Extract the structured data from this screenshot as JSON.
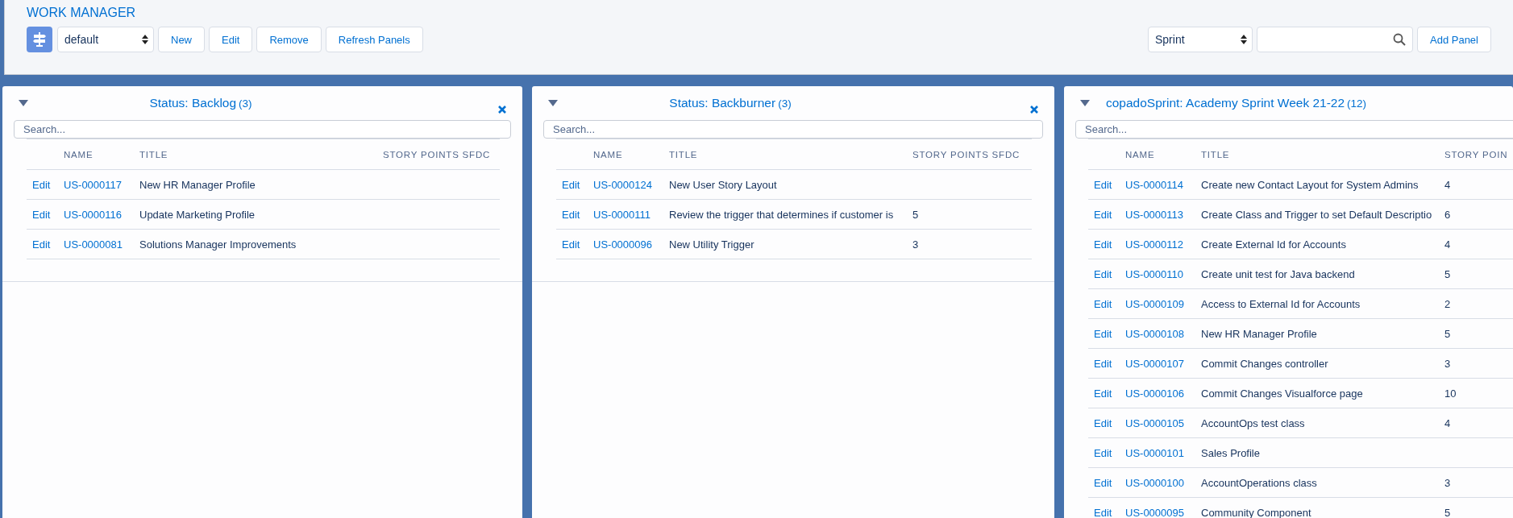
{
  "header": {
    "title": "WORK MANAGER",
    "layout_select": {
      "value": "default"
    },
    "buttons": [
      "New",
      "Edit",
      "Remove",
      "Refresh Panels"
    ],
    "panel_type_select": {
      "value": "Sprint"
    },
    "add_button": "Add Panel"
  },
  "panels": [
    {
      "title": "Status: Backlog",
      "count": "(3)",
      "expanded": true,
      "closable": true,
      "search": {
        "placeholder": "Search..."
      },
      "columns": [
        "NAME",
        "TITLE",
        "STORY POINTS SFDC"
      ],
      "rows": [
        {
          "action": "Edit",
          "name": "US-0000117",
          "title": "New HR Manager Profile"
        },
        {
          "action": "Edit",
          "name": "US-0000116",
          "title": "Update Marketing Profile"
        },
        {
          "action": "Edit",
          "name": "US-0000081",
          "title": "Solutions Manager Improvements"
        }
      ]
    },
    {
      "title": "Status: Backburner",
      "count": "(3)",
      "expanded": true,
      "closable": true,
      "search": {
        "placeholder": "Search..."
      },
      "columns": [
        "NAME",
        "TITLE",
        "STORY POINTS SFDC"
      ],
      "rows": [
        {
          "action": "Edit",
          "name": "US-0000124",
          "title": "New User Story Layout"
        },
        {
          "action": "Edit",
          "name": "US-0000111",
          "title": "Review the trigger that determines if customer is",
          "points": "5"
        },
        {
          "action": "Edit",
          "name": "US-0000096",
          "title": "New Utility Trigger",
          "points": "3"
        }
      ]
    },
    {
      "title": "copadoSprint: Academy Sprint Week 21-22",
      "count": "(12)",
      "expanded": true,
      "closable": false,
      "search": {
        "placeholder": "Search..."
      },
      "columns": [
        "NAME",
        "TITLE",
        "STORY POIN"
      ],
      "rows": [
        {
          "action": "Edit",
          "name": "US-0000114",
          "title": "Create new Contact Layout for System Admins",
          "points": "4"
        },
        {
          "action": "Edit",
          "name": "US-0000113",
          "title": "Create Class and Trigger to set Default Descriptio",
          "points": "6"
        },
        {
          "action": "Edit",
          "name": "US-0000112",
          "title": "Create External Id for Accounts",
          "points": "4"
        },
        {
          "action": "Edit",
          "name": "US-0000110",
          "title": "Create unit test for Java backend",
          "points": "5"
        },
        {
          "action": "Edit",
          "name": "US-0000109",
          "title": "Access to External Id for Accounts",
          "points": "2"
        },
        {
          "action": "Edit",
          "name": "US-0000108",
          "title": "New HR Manager Profile",
          "points": "5"
        },
        {
          "action": "Edit",
          "name": "US-0000107",
          "title": "Commit Changes controller",
          "points": "3"
        },
        {
          "action": "Edit",
          "name": "US-0000106",
          "title": "Commit Changes Visualforce page",
          "points": "10"
        },
        {
          "action": "Edit",
          "name": "US-0000105",
          "title": "AccountOps test class",
          "points": "4"
        },
        {
          "action": "Edit",
          "name": "US-0000101",
          "title": "Sales Profile"
        },
        {
          "action": "Edit",
          "name": "US-0000100",
          "title": "AccountOperations class",
          "points": "3"
        },
        {
          "action": "Edit",
          "name": "US-0000095",
          "title": "Community Component",
          "points": "5"
        }
      ]
    }
  ]
}
